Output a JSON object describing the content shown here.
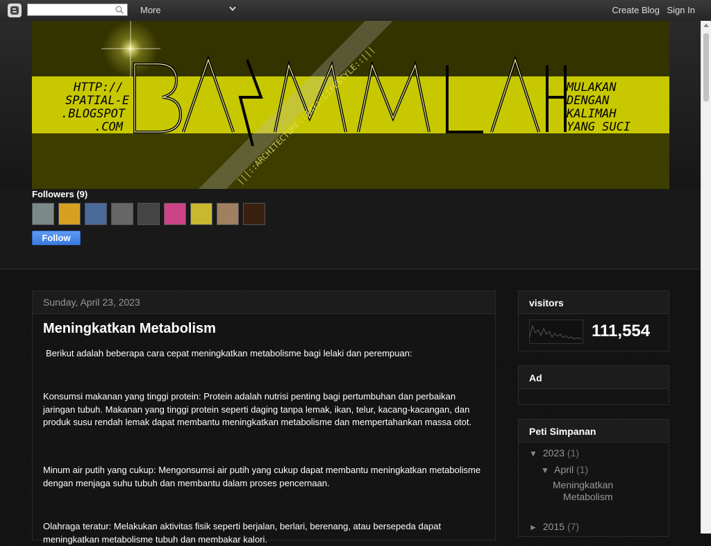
{
  "navbar": {
    "logo_icon": "blogger-icon",
    "search_value": "",
    "more_label": "More",
    "create_blog_label": "Create Blog",
    "sign_in_label": "Sign In"
  },
  "header": {
    "banner_url_text": [
      "HTTP://",
      "SPATIAL-E",
      ".BLOGSPOT",
      ".COM"
    ],
    "banner_title": "BASMALAH",
    "banner_tagline": [
      "MULAKAN",
      "DENGAN",
      "KALIMAH",
      "YANG SUCI"
    ],
    "banner_diagonal_text": "|||::ARCHITECTURE::ART::LIFESTYLE::|||",
    "accent_color": "#c8c800"
  },
  "followers": {
    "title": "Followers (9)",
    "count": 9,
    "follow_label": "Follow",
    "avatar_colors": [
      "#7a8a88",
      "#d8a020",
      "#4a6a9a",
      "#666666",
      "#444444",
      "#cc4488",
      "#c8b830",
      "#a08060",
      "#3a2010"
    ]
  },
  "post": {
    "date": "Sunday, April 23, 2023",
    "title": "Meningkatkan Metabolism",
    "paragraphs": [
      "Berikut adalah beberapa cara cepat meningkatkan metabolisme bagi lelaki dan perempuan:",
      "Konsumsi makanan yang tinggi protein: Protein adalah nutrisi penting bagi pertumbuhan dan perbaikan jaringan tubuh. Makanan yang tinggi protein seperti daging tanpa lemak, ikan, telur, kacang-kacangan, dan produk susu rendah lemak dapat membantu meningkatkan metabolisme dan mempertahankan massa otot.",
      "Minum air putih yang cukup: Mengonsumsi air putih yang cukup dapat membantu meningkatkan metabolisme dengan menjaga suhu tubuh dan membantu dalam proses pencernaan.",
      "Olahraga teratur: Melakukan aktivitas fisik seperti berjalan, berlari, berenang, atau bersepeda dapat meningkatkan metabolisme tubuh dan membakar kalori."
    ]
  },
  "sidebar": {
    "visitors": {
      "title": "visitors",
      "count": "111,554"
    },
    "ad": {
      "title": "Ad"
    },
    "archive": {
      "title": "Peti Simpanan",
      "year_2023": {
        "toggle": "▼",
        "label": "2023",
        "count": "(1)"
      },
      "month_april": {
        "toggle": "▼",
        "label": "April",
        "count": "(1)"
      },
      "post_link_line1": "Meningkatkan",
      "post_link_line2": "Metabolism",
      "year_2015": {
        "toggle": "►",
        "label": "2015",
        "count": "(7)"
      }
    }
  }
}
